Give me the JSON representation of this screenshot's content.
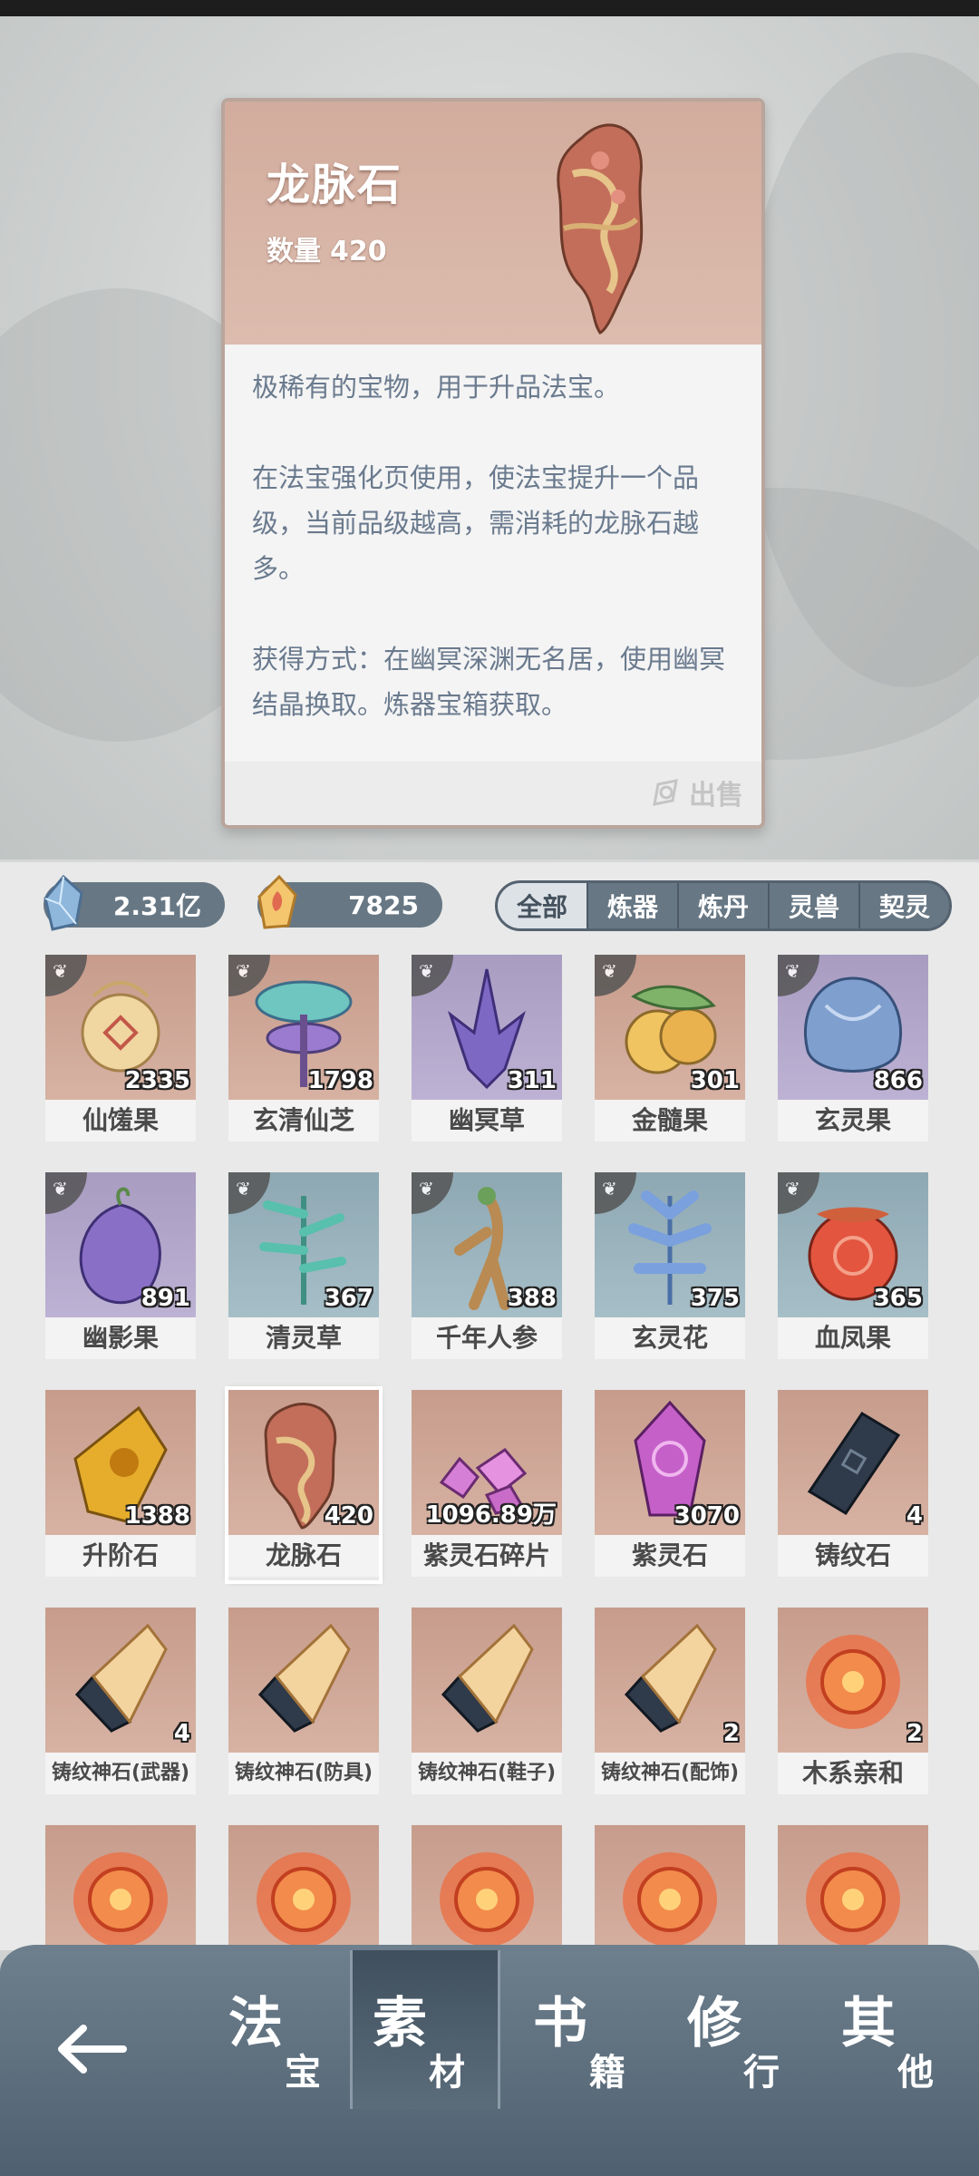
{
  "detail": {
    "name": "龙脉石",
    "quantity_label": "数量",
    "quantity": "420",
    "desc1": "极稀有的宝物，用于升品法宝。",
    "desc2": "在法宝强化页使用，使法宝提升一个品级，当前品级越高，需消耗的龙脉石越多。",
    "desc3": "获得方式：在幽冥深渊无名居，使用幽冥结晶换取。炼器宝箱获取。",
    "sell_label": "出售"
  },
  "currency": {
    "spirit_stone": "2.31亿",
    "gold": "7825"
  },
  "filter_tabs": [
    "全部",
    "炼器",
    "炼丹",
    "灵兽",
    "契灵"
  ],
  "active_tab": "全部",
  "items": [
    {
      "name": "仙馐果",
      "count": "2335"
    },
    {
      "name": "玄清仙芝",
      "count": "1798"
    },
    {
      "name": "幽冥草",
      "count": "311"
    },
    {
      "name": "金髓果",
      "count": "301"
    },
    {
      "name": "玄灵果",
      "count": "866"
    },
    {
      "name": "幽影果",
      "count": "891"
    },
    {
      "name": "清灵草",
      "count": "367"
    },
    {
      "name": "千年人参",
      "count": "388"
    },
    {
      "name": "玄灵花",
      "count": "375"
    },
    {
      "name": "血凤果",
      "count": "365"
    },
    {
      "name": "升阶石",
      "count": "1388"
    },
    {
      "name": "龙脉石",
      "count": "420"
    },
    {
      "name": "紫灵石碎片",
      "count": "1096.89万"
    },
    {
      "name": "紫灵石",
      "count": "3070"
    },
    {
      "name": "铸纹石",
      "count": "4"
    },
    {
      "name": "铸纹神石(武器)",
      "count": "4"
    },
    {
      "name": "铸纹神石(防具)",
      "count": ""
    },
    {
      "name": "铸纹神石(鞋子)",
      "count": ""
    },
    {
      "name": "铸纹神石(配饰)",
      "count": "2"
    },
    {
      "name": "木系亲和",
      "count": "2"
    }
  ],
  "bottom_nav": [
    {
      "big": "法",
      "small": "宝"
    },
    {
      "big": "素",
      "small": "材"
    },
    {
      "big": "书",
      "small": "籍"
    },
    {
      "big": "修",
      "small": "行"
    },
    {
      "big": "其",
      "small": "他"
    }
  ],
  "active_nav": "素材"
}
